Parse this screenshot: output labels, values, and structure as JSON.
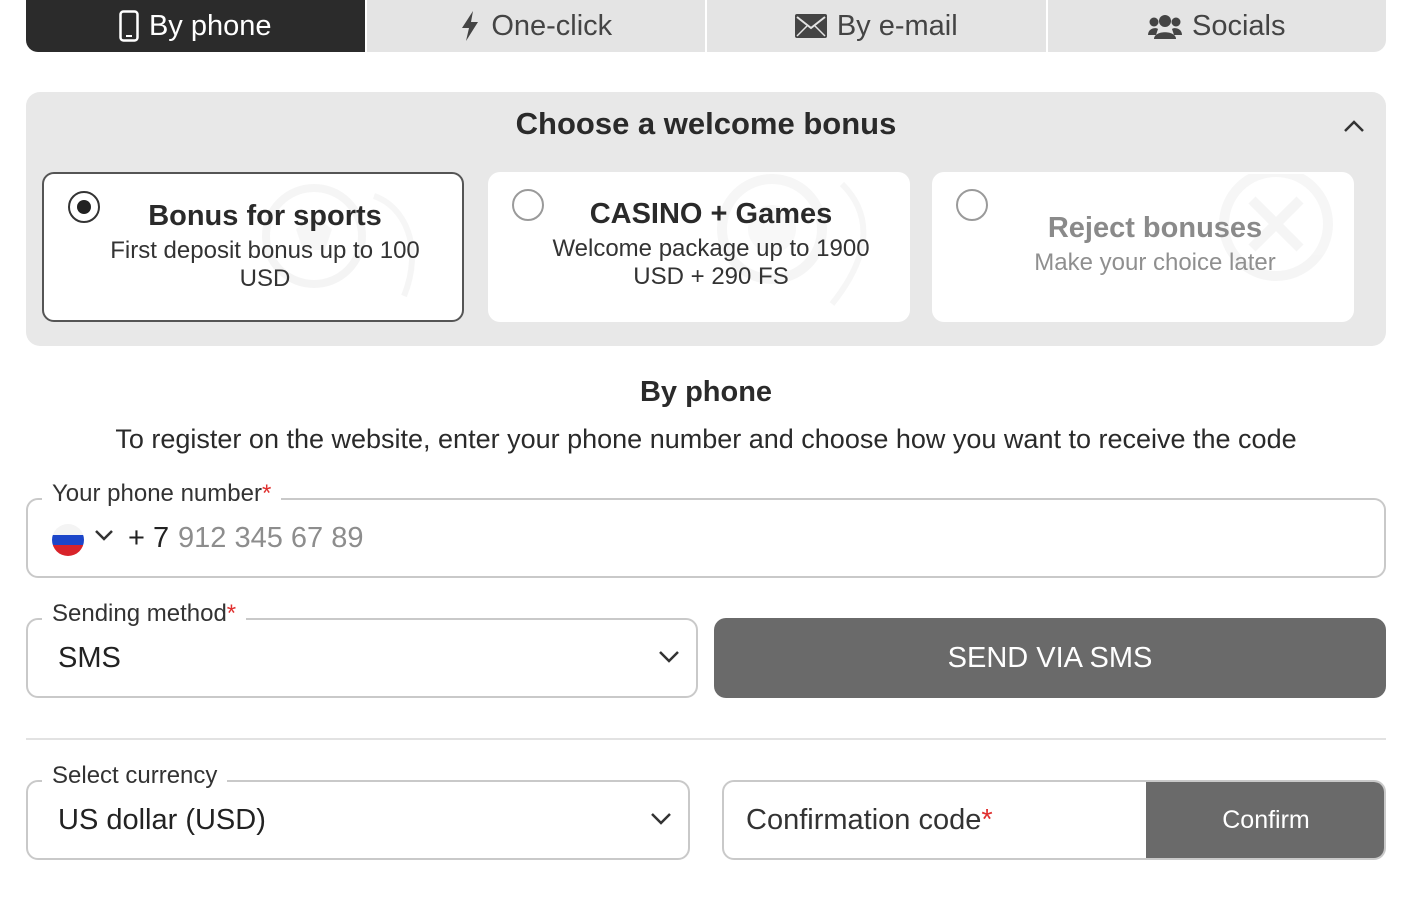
{
  "tabs": [
    {
      "label": "By phone",
      "icon": "smartphone-icon",
      "active": true
    },
    {
      "label": "One-click",
      "icon": "lightning-icon",
      "active": false
    },
    {
      "label": "By e-mail",
      "icon": "envelope-icon",
      "active": false
    },
    {
      "label": "Socials",
      "icon": "users-icon",
      "active": false
    }
  ],
  "bonus": {
    "title": "Choose a welcome bonus",
    "options": [
      {
        "name": "Bonus for sports",
        "desc": "First deposit bonus up to 100 USD",
        "selected": true
      },
      {
        "name": "CASINO + Games",
        "desc": "Welcome package up to 1900 USD + 290 FS",
        "selected": false
      },
      {
        "name": "Reject bonuses",
        "desc": "Make your choice later",
        "selected": false
      }
    ]
  },
  "section": {
    "title": "By phone",
    "description": "To register on the website, enter your phone number and choose how you want to receive the code"
  },
  "phone": {
    "label": "Your phone number",
    "required_mark": "*",
    "country_flag": "russia-flag-icon",
    "prefix": "+ 7",
    "placeholder": "912 345 67 89"
  },
  "sending_method": {
    "label": "Sending method",
    "required_mark": "*",
    "value": "SMS"
  },
  "send_button": "SEND VIA SMS",
  "currency": {
    "label": "Select currency",
    "value": "US dollar (USD)"
  },
  "confirmation": {
    "placeholder": "Confirmation code",
    "required_mark": "*",
    "button": "Confirm"
  },
  "colors": {
    "tab_active": "#2b2b2b",
    "tab_inactive": "#e4e4e4",
    "panel_bg": "#e8e8e8",
    "button_bg": "#6a6a6a",
    "required": "#e0302f"
  }
}
